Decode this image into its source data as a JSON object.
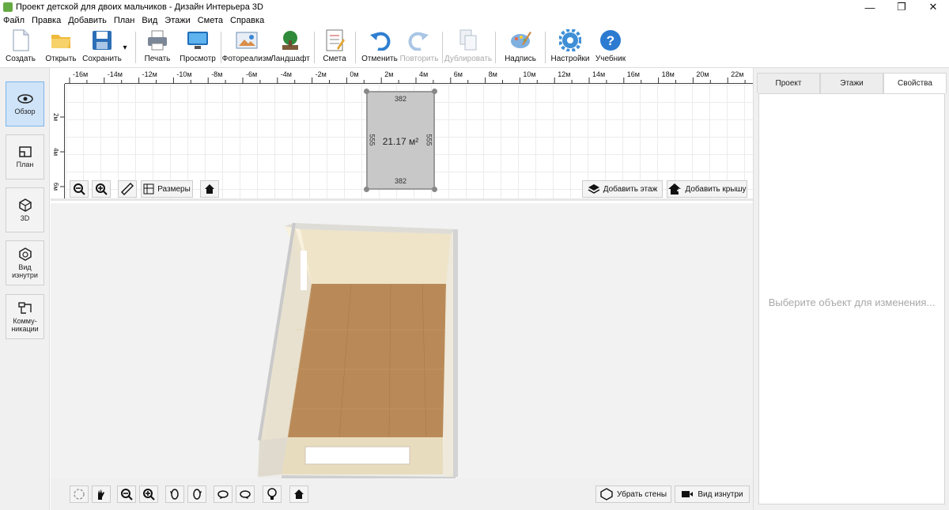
{
  "window": {
    "title": "Проект детской для двоих мальчиков - Дизайн Интерьера 3D",
    "minimize": "—",
    "maximize": "❐",
    "close": "✕"
  },
  "menu": [
    "Файл",
    "Правка",
    "Добавить",
    "План",
    "Вид",
    "Этажи",
    "Смета",
    "Справка"
  ],
  "toolbar": {
    "create": "Создать",
    "open": "Открыть",
    "save": "Сохранить",
    "save_arrow": "▾",
    "print": "Печать",
    "preview": "Просмотр",
    "photoreal": "Фотореализм",
    "landscape": "Ландшафт",
    "estimate": "Смета",
    "undo": "Отменить",
    "redo": "Повторить",
    "duplicate": "Дублировать",
    "label": "Надпись",
    "settings": "Настройки",
    "tutorial": "Учебник"
  },
  "sidebar": {
    "overview": "Обзор",
    "plan": "План",
    "view3d": "3D",
    "inside": "Вид изнутри",
    "utilities": "Комму-\nникации"
  },
  "ruler_h": [
    "-16м",
    "-14м",
    "-12м",
    "-10м",
    "-8м",
    "-6м",
    "-4м",
    "-2м",
    "0м",
    "2м",
    "4м",
    "6м",
    "8м",
    "10м",
    "12м",
    "14м",
    "16м",
    "18м",
    "20м",
    "22м"
  ],
  "ruler_v": [
    "2м",
    "4м",
    "6м"
  ],
  "room": {
    "area": "21.17 м²",
    "width_top": "382",
    "width_bottom": "382",
    "height_left": "555",
    "height_right": "555"
  },
  "plan_buttons": {
    "dimensions": "Размеры",
    "add_floor": "Добавить этаж",
    "add_roof": "Добавить крышу"
  },
  "bottom_buttons": {
    "remove_walls": "Убрать стены",
    "inside_view": "Вид изнутри"
  },
  "right_panel": {
    "tabs": [
      "Проект",
      "Этажи",
      "Свойства"
    ],
    "active_tab": "Свойства",
    "hint": "Выберите объект для изменения..."
  },
  "colors": {
    "accent": "#7eb4ea",
    "floor": "#b98a57",
    "wall": "#efe6cf"
  }
}
